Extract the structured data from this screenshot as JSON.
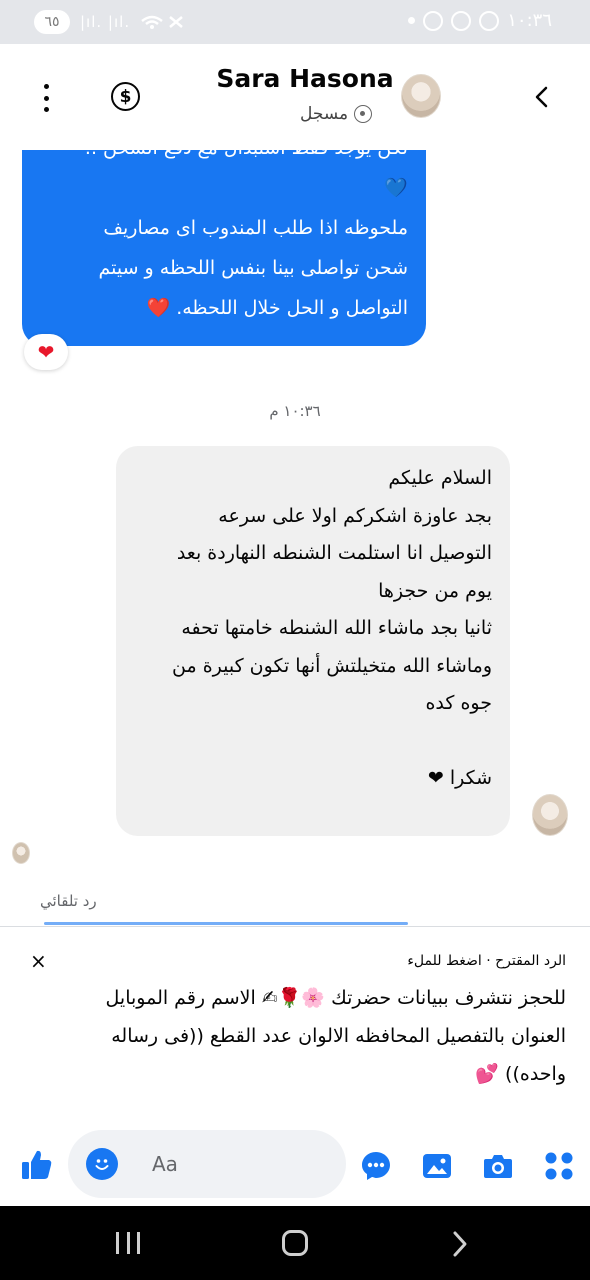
{
  "status_bar": {
    "battery": "٦٥",
    "signal": "|ıl. |ıl.",
    "time": "١٠:٣٦"
  },
  "header": {
    "contact_name": "Sara Hasona",
    "contact_status": "مسجل"
  },
  "outgoing_message": {
    "lines": [
      "لكن يوجد فقط استبدال مع دفع الشحن ..",
      "💙",
      "ملحوظه اذا طلب المندوب اى مصاريف",
      "شحن تواصلى بينا بنفس اللحظه و سيتم",
      "التواصل و الحل خلال اللحظه. ❤️"
    ],
    "reaction": "❤"
  },
  "timestamp": "١٠:٣٦ م",
  "incoming_message": {
    "lines": [
      "السلام عليكم",
      "بجد عاوزة اشكركم اولا  على سرعه",
      "التوصيل انا استلمت الشنطه النهاردة بعد",
      "يوم من حجزها",
      "ثانيا بجد ماشاء الله الشنطه خامتها تحفه",
      "وماشاء الله متخيلتش أنها تكون كبيرة من",
      "جوه كده",
      "",
      "شكرا ❤"
    ]
  },
  "auto_reply_label": "رد تلقائي",
  "suggested_reply": {
    "header": "الرد المقترح · اضغط للملء",
    "close_label": "×",
    "lines": [
      "للحجز نتشرف ببيانات حضرتك 🌸🌹✍ الاسم رقم الموبايل",
      "العنوان بالتفصيل المحافظه الالوان عدد القطع ((فى رساله",
      "واحده)) 💕"
    ]
  },
  "composer": {
    "placeholder": "Aa"
  },
  "colors": {
    "accent": "#1877f2",
    "outgoing_bubble": "#1877f2",
    "incoming_bubble": "#f0f0f0",
    "heart": "#e8172b"
  },
  "icons": [
    "more-icon",
    "dollar-icon",
    "back-icon",
    "like-icon",
    "emoji-icon",
    "chat-icon",
    "gallery-icon",
    "camera-icon",
    "apps-icon",
    "close-icon"
  ]
}
